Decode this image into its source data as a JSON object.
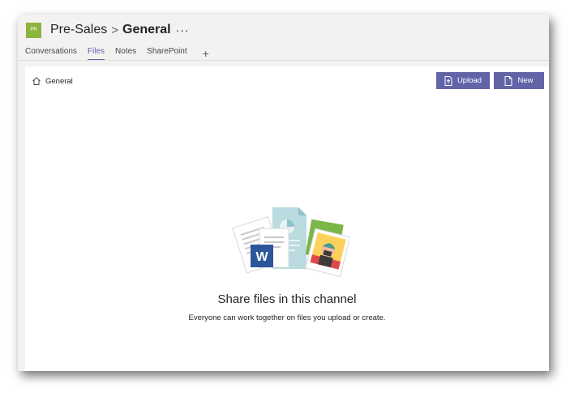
{
  "header": {
    "avatar_initials": "PR",
    "team_name": "Pre-Sales",
    "separator": ">",
    "channel_name": "General",
    "more_label": "···"
  },
  "tabs": [
    {
      "label": "Conversations",
      "active": false
    },
    {
      "label": "Files",
      "active": true
    },
    {
      "label": "Notes",
      "active": false
    },
    {
      "label": "SharePoint",
      "active": false
    }
  ],
  "add_tab_label": "+",
  "breadcrumb": {
    "label": "General"
  },
  "toolbar": {
    "upload_label": "Upload",
    "new_label": "New"
  },
  "empty_state": {
    "title": "Share files in this channel",
    "subtitle": "Everyone can work together on files you upload or create."
  },
  "colors": {
    "accent": "#6264a7",
    "avatar": "#8cb33c",
    "word": "#2b579a"
  }
}
